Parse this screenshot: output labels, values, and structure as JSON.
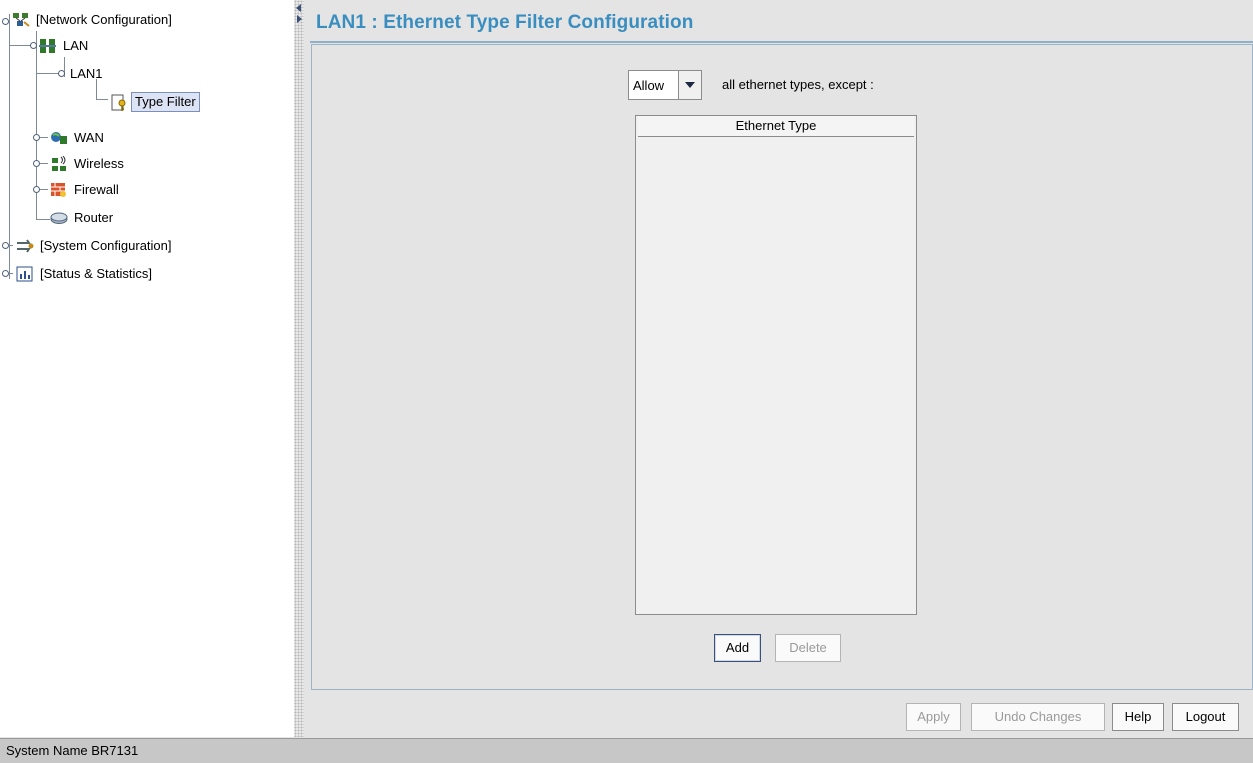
{
  "tree": {
    "network_configuration": "[Network Configuration]",
    "lan": "LAN",
    "lan1": "LAN1",
    "type_filter": "Type Filter",
    "wan": "WAN",
    "wireless": "Wireless",
    "firewall": "Firewall",
    "router": "Router",
    "system_configuration": "[System Configuration]",
    "status_statistics": "[Status & Statistics]"
  },
  "header": {
    "title": "LAN1 : Ethernet Type Filter Configuration"
  },
  "filter": {
    "mode_value": "Allow",
    "except_text": "all ethernet types, except :",
    "table_header": "Ethernet Type",
    "rows": []
  },
  "buttons": {
    "add": "Add",
    "delete": "Delete",
    "apply": "Apply",
    "undo": "Undo Changes",
    "help": "Help",
    "logout": "Logout"
  },
  "status_bar": {
    "text": "System Name BR7131"
  },
  "colors": {
    "title": "#3a8ebf",
    "selection": "#dce3f5",
    "status_bar_bg": "#c7c7c7"
  }
}
